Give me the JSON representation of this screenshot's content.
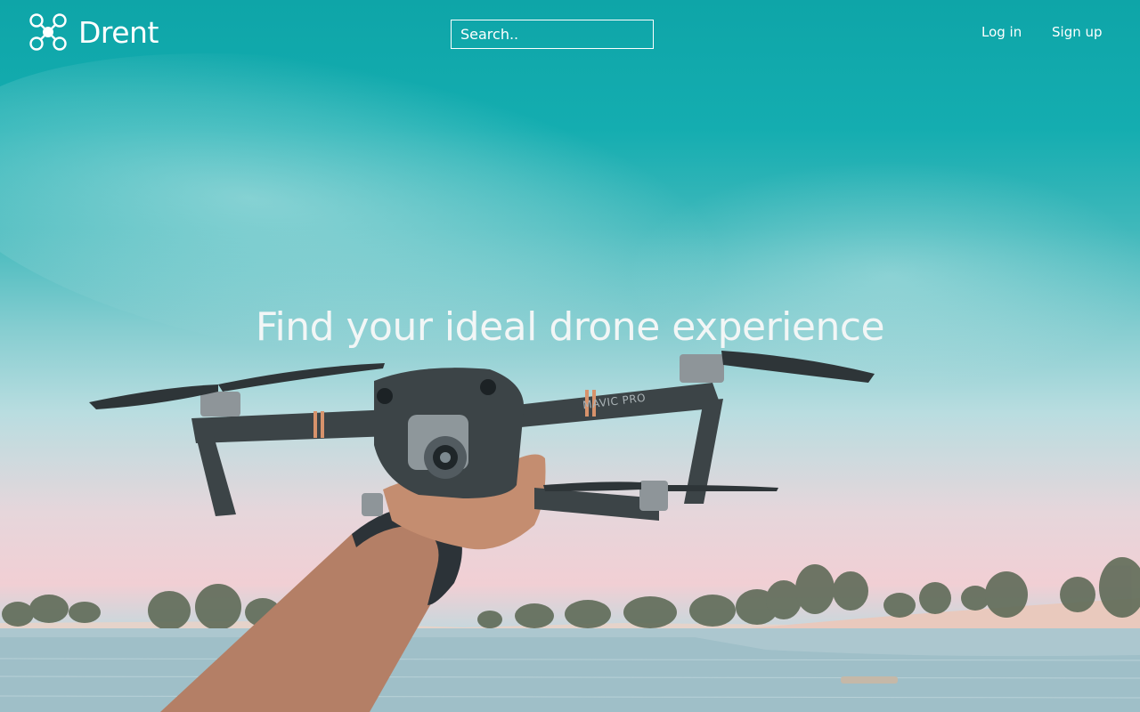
{
  "brand": {
    "name": "Drent",
    "logo_icon": "drone-logo-icon"
  },
  "search": {
    "placeholder": "Search.."
  },
  "nav": {
    "login_label": "Log in",
    "signup_label": "Sign up"
  },
  "hero": {
    "title": "Find your ideal drone experience",
    "image_subject": "hand holding a drone over a lake at dusk",
    "drone_label": "MAVIC PRO"
  },
  "colors": {
    "sky_top": "#0ea5a8",
    "sky_mid": "#85cdd0",
    "horizon": "#f1cfd4",
    "water": "#a9c6cf",
    "text": "#ffffff"
  }
}
